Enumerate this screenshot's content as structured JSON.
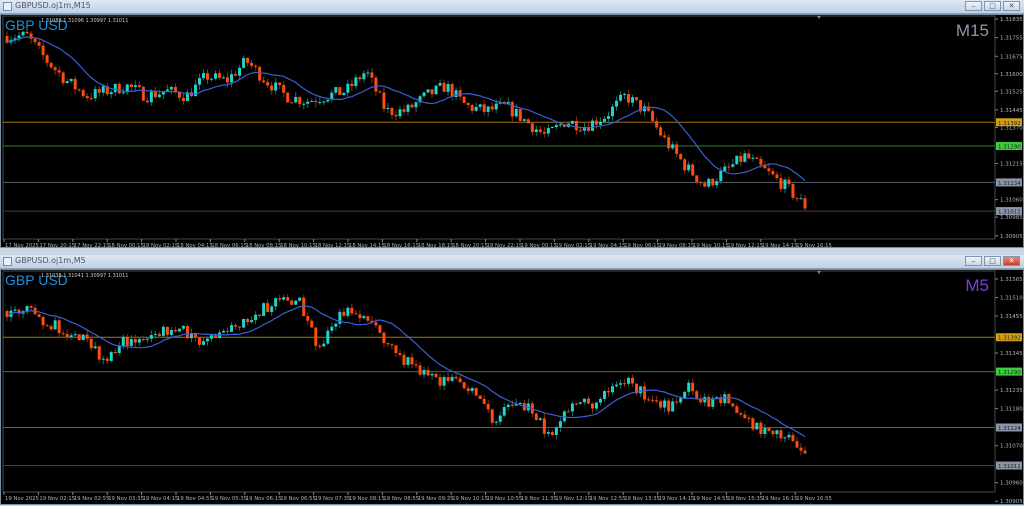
{
  "colors": {
    "bull": "#22d3c8",
    "bull_wick": "#1a7070",
    "bear": "#ff4c0c",
    "bear_wick": "#8a3510",
    "ma": "#3a5fd6",
    "axis_text": "#b0b0b0"
  },
  "windows": [
    {
      "title": "GBPUSD.oj1m,M15",
      "symbol": "GBP USD",
      "ohlc": "1.31088 1.31096 1.30997 1.31011",
      "timeframe": "M15",
      "timeframe_color": "#8a96a8",
      "chart_data": {
        "type": "candlestick",
        "candle_count": 200,
        "price_path": [
          1.31762,
          1.31762,
          1.31655,
          1.31569,
          1.31505,
          1.31526,
          1.31548,
          1.31505,
          1.31526,
          1.31505,
          1.3159,
          1.31569,
          1.31655,
          1.31569,
          1.31505,
          1.31483,
          1.31505,
          1.31526,
          1.31612,
          1.3144,
          1.3144,
          1.31505,
          1.31548,
          1.31462,
          1.3144,
          1.31462,
          1.31397,
          1.31333,
          1.31397,
          1.31376,
          1.31419,
          1.31505,
          1.3144,
          1.31312,
          1.31204,
          1.31119,
          1.31183,
          1.31247,
          1.31183,
          1.31119,
          1.31033
        ],
        "price_ticks": [
          "1.31835",
          "1.31755",
          "1.31675",
          "1.31600",
          "1.31525",
          "1.31445",
          "1.31370",
          "1.31215",
          "1.31060",
          "1.30985",
          "1.30905"
        ],
        "levels": [
          {
            "price": "1.31392",
            "color": "#d4a017",
            "line": "#a07810"
          },
          {
            "price": "1.31290",
            "color": "#3ccf3c",
            "line": "#2e7d2e"
          },
          {
            "price": "1.31134",
            "color": "#8a96a8",
            "line": "#55606c"
          },
          {
            "price": "1.31011",
            "color": "#8a96a8",
            "line": "#3a4048"
          }
        ],
        "time_labels": [
          "17 Nov 2025",
          "17 Nov 20:15",
          "17 Nov 22:15",
          "18 Nov 00:15",
          "18 Nov 02:15",
          "18 Nov 04:15",
          "18 Nov 06:15",
          "18 Nov 08:15",
          "18 Nov 10:15",
          "18 Nov 12:15",
          "18 Nov 14:15",
          "18 Nov 16:15",
          "18 Nov 18:15",
          "18 Nov 20:15",
          "18 Nov 22:15",
          "19 Nov 00:15",
          "19 Nov 02:15",
          "19 Nov 04:15",
          "19 Nov 06:15",
          "19 Nov 08:15",
          "19 Nov 10:15",
          "19 Nov 12:15",
          "19 Nov 14:15",
          "19 Nov 16:15"
        ]
      }
    },
    {
      "title": "GBPUSD.oj1m,M5",
      "symbol": "GBP USD",
      "ohlc": "1.31038 1.31041 1.30997 1.31011",
      "timeframe": "M5",
      "timeframe_color": "#7b3fd0",
      "chart_data": {
        "type": "candlestick",
        "candle_count": 200,
        "price_path": [
          1.3147,
          1.3147,
          1.3144,
          1.31411,
          1.31396,
          1.31321,
          1.31381,
          1.31381,
          1.31411,
          1.31411,
          1.31366,
          1.31396,
          1.31425,
          1.3147,
          1.315,
          1.315,
          1.31366,
          1.31455,
          1.3147,
          1.31411,
          1.31351,
          1.31292,
          1.31262,
          1.31262,
          1.31232,
          1.31143,
          1.31203,
          1.31173,
          1.31084,
          1.31203,
          1.31188,
          1.31247,
          1.31262,
          1.31203,
          1.31188,
          1.31247,
          1.31188,
          1.31218,
          1.31143,
          1.31114,
          1.31099,
          1.31048
        ],
        "price_ticks": [
          "1.31565",
          "1.31510",
          "1.31455",
          "1.31345",
          "1.31235",
          "1.31180",
          "1.31070",
          "1.30960",
          "1.30905"
        ],
        "levels": [
          {
            "price": "1.31392",
            "color": "#d4a017",
            "line": "#a07810"
          },
          {
            "price": "1.31290",
            "color": "#3ccf3c",
            "line": "#2e7d2e"
          },
          {
            "price": "1.31124",
            "color": "#8a96a8",
            "line": "#55606c"
          },
          {
            "price": "1.31011",
            "color": "#8a96a8",
            "line": "#3a4048"
          }
        ],
        "time_labels": [
          "19 Nov 2025",
          "19 Nov 02:15",
          "19 Nov 02:55",
          "19 Nov 03:35",
          "19 Nov 04:15",
          "19 Nov 04:55",
          "19 Nov 05:35",
          "19 Nov 06:15",
          "19 Nov 06:55",
          "19 Nov 07:35",
          "19 Nov 08:15",
          "19 Nov 08:55",
          "19 Nov 09:35",
          "19 Nov 10:15",
          "19 Nov 10:55",
          "19 Nov 11:35",
          "19 Nov 12:15",
          "19 Nov 12:55",
          "19 Nov 13:35",
          "19 Nov 14:15",
          "19 Nov 14:55",
          "19 Nov 15:35",
          "19 Nov 16:15",
          "19 Nov 16:55"
        ]
      }
    }
  ],
  "window_buttons": {
    "minimize": "–",
    "maximize": "□",
    "close": "✕"
  }
}
